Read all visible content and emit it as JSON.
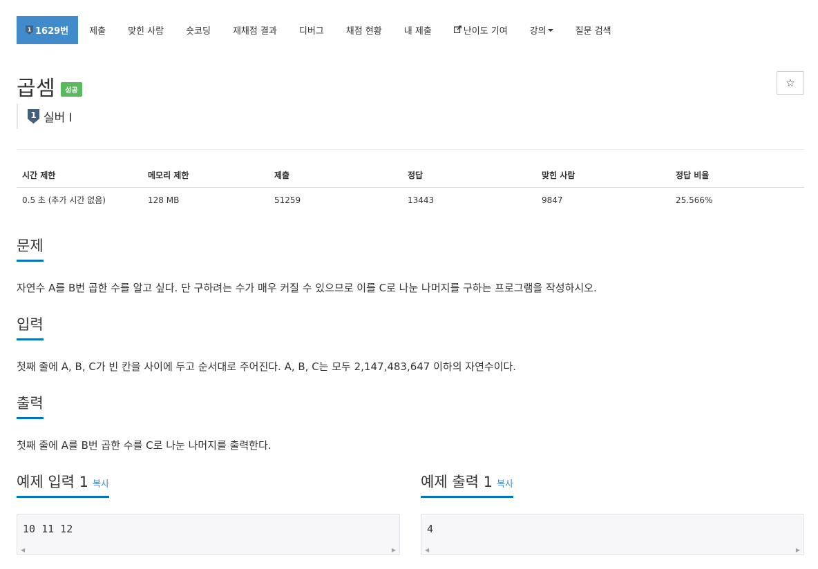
{
  "nav": {
    "tabs": [
      {
        "label": "1629번",
        "active": true
      },
      {
        "label": "제출"
      },
      {
        "label": "맞힌 사람"
      },
      {
        "label": "숏코딩"
      },
      {
        "label": "재채점 결과"
      },
      {
        "label": "디버그"
      },
      {
        "label": "채점 현황"
      },
      {
        "label": "내 제출"
      },
      {
        "label": "난이도 기여",
        "icon": "external-link-icon"
      },
      {
        "label": "강의",
        "icon": "caret-down-icon"
      },
      {
        "label": "질문 검색"
      }
    ],
    "tier_glyph": "1"
  },
  "problem": {
    "title": "곱셈",
    "status_badge": "성공",
    "star_icon": "☆",
    "tier_number": "1",
    "tier_label": "실버 I"
  },
  "info": {
    "headers": [
      "시간 제한",
      "메모리 제한",
      "제출",
      "정답",
      "맞힌 사람",
      "정답 비율"
    ],
    "values": [
      "0.5 초 (추가 시간 없음)",
      "128 MB",
      "51259",
      "13443",
      "9847",
      "25.566%"
    ]
  },
  "sections": {
    "problem_title": "문제",
    "problem_text": "자연수 A를 B번 곱한 수를 알고 싶다. 단 구하려는 수가 매우 커질 수 있으므로 이를 C로 나눈 나머지를 구하는 프로그램을 작성하시오.",
    "input_title": "입력",
    "input_text": "첫째 줄에 A, B, C가 빈 칸을 사이에 두고 순서대로 주어진다. A, B, C는 모두 2,147,483,647 이하의 자연수이다.",
    "output_title": "출력",
    "output_text": "첫째 줄에 A를 B번 곱한 수를 C로 나눈 나머지를 출력한다."
  },
  "samples": {
    "input_title": "예제 입력 1",
    "output_title": "예제 출력 1",
    "copy_label": "복사",
    "input_value": "10 11 12",
    "output_value": "4"
  },
  "colors": {
    "accent": "#428bca",
    "success": "#5cb85c",
    "underline": "#0076c0",
    "tier_silver": "#435f7a"
  }
}
